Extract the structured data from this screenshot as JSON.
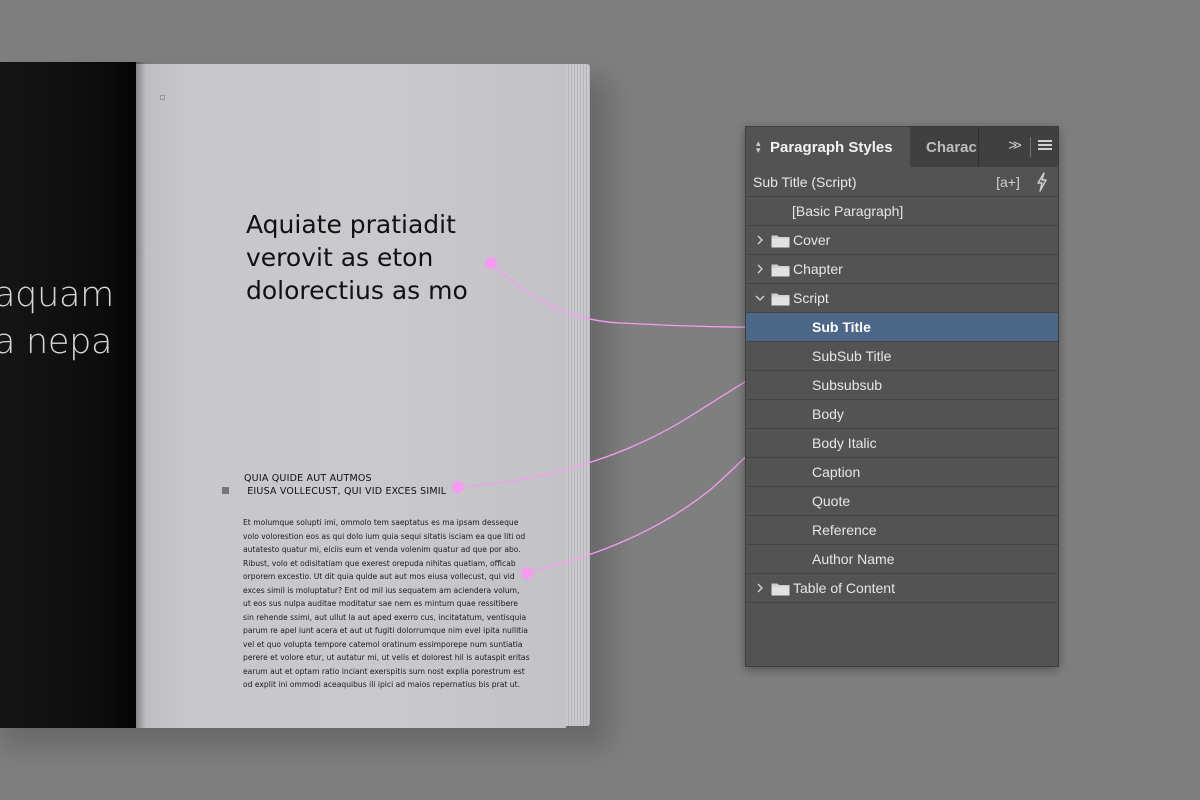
{
  "book": {
    "left_page_lines": [
      "aquam",
      "a nepa"
    ],
    "title_lines": [
      "Aquiate pratiadit",
      "verovit as eton",
      "dolorectius as mo"
    ],
    "subsub_lines": [
      "QUIA QUIDE AUT AUTMOS",
      " EIUSA VOLLECUST, QUI VID EXCES SIMIL"
    ],
    "body_lines": [
      "Et molumque solupti imi, ommolo tem saeptatus es ma ipsam desseque",
      "volo volorestion eos as qui dolo ium quia sequi sitatis isciam ea que liti od",
      "autatesto quatur mi, eiciis eum et venda volenim quatur ad que por abo.",
      "Ribust, volo et odisitatiam que exerest orepuda nihitas quatiam, officab",
      "orporem excestio. Ut dit quia quide aut aut mos eiusa vollecust, qui vid",
      "exces simil is moluptatur? Ent od mil ius sequatem am aciendera volum,",
      "ut eos sus nulpa auditae moditatur sae nem es mintum quae ressitibere",
      "sin rehende ssimi, aut ullut la aut aped exerro cus, incitatatum, ventisquia",
      "parum re apel iunt acera et aut ut fugiti dolorrumque nim evel ipita nullitia",
      "vel et quo volupta tempore catemol oratinum essimporepe num suntiatia",
      "perere et volore etur, ut autatur mi, ut velis et dolorest hil is autaspit eritas",
      "earum aut et optam ratio inciant exerspitis sum nost explia porestrum est",
      "od explit ini ommodi aceaquibus ili ipici ad maios repernatius bis prat ut."
    ]
  },
  "panel": {
    "active_tab": "Paragraph Styles",
    "inactive_tab": "Charac",
    "current_style": "Sub Title (Script)",
    "new_style_label": "[a+]",
    "styles": [
      {
        "label": "[Basic Paragraph]",
        "kind": "style",
        "indent": 0,
        "selected": false
      },
      {
        "label": "Cover",
        "kind": "group",
        "expanded": false,
        "indent": 0,
        "selected": false
      },
      {
        "label": "Chapter",
        "kind": "group",
        "expanded": false,
        "indent": 0,
        "selected": false
      },
      {
        "label": "Script",
        "kind": "group",
        "expanded": true,
        "indent": 0,
        "selected": false
      },
      {
        "label": "Sub Title",
        "kind": "style",
        "indent": 1,
        "selected": true
      },
      {
        "label": "SubSub Title",
        "kind": "style",
        "indent": 1,
        "selected": false
      },
      {
        "label": "Subsubsub",
        "kind": "style",
        "indent": 1,
        "selected": false
      },
      {
        "label": "Body",
        "kind": "style",
        "indent": 1,
        "selected": false
      },
      {
        "label": "Body Italic",
        "kind": "style",
        "indent": 1,
        "selected": false
      },
      {
        "label": "Caption",
        "kind": "style",
        "indent": 1,
        "selected": false
      },
      {
        "label": "Quote",
        "kind": "style",
        "indent": 1,
        "selected": false
      },
      {
        "label": "Reference",
        "kind": "style",
        "indent": 1,
        "selected": false
      },
      {
        "label": "Author Name",
        "kind": "style",
        "indent": 1,
        "selected": false
      },
      {
        "label": "Table of Content",
        "kind": "group",
        "expanded": false,
        "indent": 0,
        "selected": false
      }
    ]
  },
  "colors": {
    "background": "#7f7f7f",
    "panel_bg": "#535353",
    "selection": "#4c6787",
    "connector": "#f59cf0"
  }
}
